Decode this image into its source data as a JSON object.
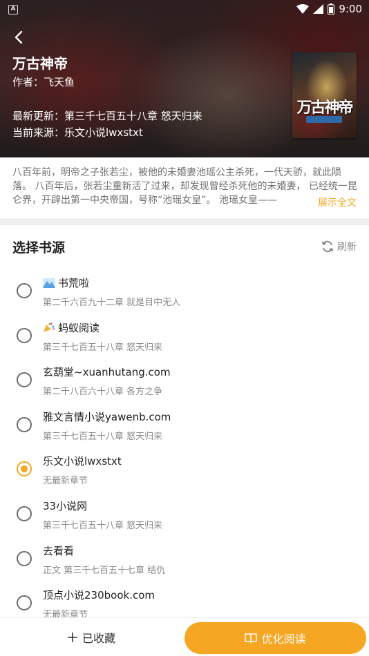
{
  "status_bar": {
    "time": "9:00"
  },
  "book": {
    "title": "万古神帝",
    "author": "作者：飞天鱼",
    "latest_update": "最新更新：第三千七百五十八章 怒天归来",
    "current_source": "当前来源：乐文小说lwxstxt",
    "cover_title": "万古神帝"
  },
  "description": {
    "text": "八百年前，明帝之子张若尘，被他的未婚妻池瑶公主杀死，一代天骄，就此陨落。 八百年后，张若尘重新活了过来，却发现曾经杀死他的未婚妻， 已经统一昆仑界，开辟出第一中央帝国，号称“池瑶女皇”。 池瑶女皇——",
    "expand_label": "展示全文"
  },
  "sources": {
    "title": "选择书源",
    "refresh_label": "刷新",
    "items": [
      {
        "name": "书荒啦",
        "chapter": "第二千六百九十二章 就是目中无人",
        "icon": "mountain-emoji-icon",
        "selected": false
      },
      {
        "name": "蚂蚁阅读",
        "chapter": "第三千七百五十八章 怒天归来",
        "icon": "party-popper-emoji-icon",
        "selected": false
      },
      {
        "name": "玄葫堂~xuanhutang.com",
        "chapter": "第二千八百六十八章 各方之争",
        "icon": "",
        "selected": false
      },
      {
        "name": "雅文言情小说yawenb.com",
        "chapter": "第三千七百五十八章 怒天归来",
        "icon": "",
        "selected": false
      },
      {
        "name": "乐文小说lwxstxt",
        "chapter": "无最新章节",
        "icon": "",
        "selected": true
      },
      {
        "name": "33小说网",
        "chapter": "第三千七百五十八章 怒天归来",
        "icon": "",
        "selected": false
      },
      {
        "name": "去看看",
        "chapter": "正文 第三千七百五十七章 结仇",
        "icon": "",
        "selected": false
      },
      {
        "name": "顶点小说230book.com",
        "chapter": "无最新章节",
        "icon": "",
        "selected": false
      }
    ]
  },
  "bottom_bar": {
    "collect_label": "已收藏",
    "read_label": "优化阅读"
  },
  "colors": {
    "accent": "#f5a623"
  }
}
